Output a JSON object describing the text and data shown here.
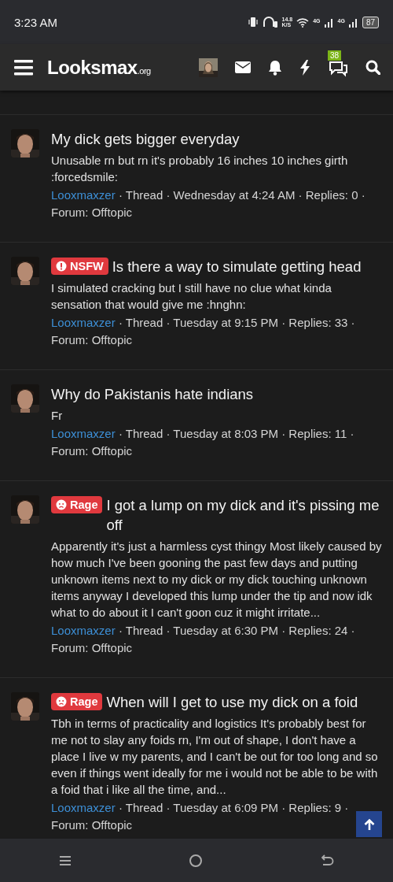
{
  "status_bar": {
    "time": "3:23 AM",
    "speed_value": "14.8",
    "speed_unit": "K/S",
    "network_1": "4G",
    "network_2": "4G",
    "battery": "87"
  },
  "header": {
    "logo": "Looksmax",
    "logo_suffix": ".org",
    "conversations_badge": "38"
  },
  "threads": [
    {
      "title": "My dick gets bigger everyday",
      "snippet": "Unusable rn but rn it's probably 16 inches 10 inches girth :forcedsmile:",
      "author": "Looxmaxzer",
      "meta": "· Thread · Wednesday at 4:24 AM · Replies: 0 · Forum: Offtopic"
    },
    {
      "prefix": {
        "kind": "nsfw",
        "label": "NSFW"
      },
      "title": "Is there a way to simulate getting head",
      "snippet": "I simulated cracking but I still have no clue what kinda sensation that would give me :hnghn:",
      "author": "Looxmaxzer",
      "meta": "· Thread · Tuesday at 9:15 PM · Replies: 33 · Forum: Offtopic"
    },
    {
      "title": "Why do Pakistanis hate indians",
      "snippet": "Fr",
      "author": "Looxmaxzer",
      "meta": "· Thread · Tuesday at 8:03 PM · Replies: 11 · Forum: Offtopic"
    },
    {
      "prefix": {
        "kind": "rage",
        "label": "Rage"
      },
      "title": "I got a lump on my dick and it's pissing me off",
      "snippet": "Apparently it's just a harmless cyst thingy Most likely caused by how much I've been gooning the past few days and putting unknown items next to my dick or my dick touching unknown items anyway I developed this lump under the tip and now idk what to do about it I can't goon cuz it might irritate...",
      "author": "Looxmaxzer",
      "meta": "· Thread · Tuesday at 6:30 PM · Replies: 24 · Forum: Offtopic"
    },
    {
      "prefix": {
        "kind": "rage",
        "label": "Rage"
      },
      "title": "When will I get to use my dick on a foid",
      "snippet": "Tbh in terms of practicality and logistics It's probably best for me not to slay any foids rn, I'm out of shape, I don't have a place I live w my parents, and I can't be out for too long and so even if things went ideally for me i would not be able to be with a foid that i like all the time, and...",
      "author": "Looxmaxzer",
      "meta": "· Thread · Tuesday at 6:09 PM · Replies: 9 · Forum: Offtopic"
    }
  ]
}
